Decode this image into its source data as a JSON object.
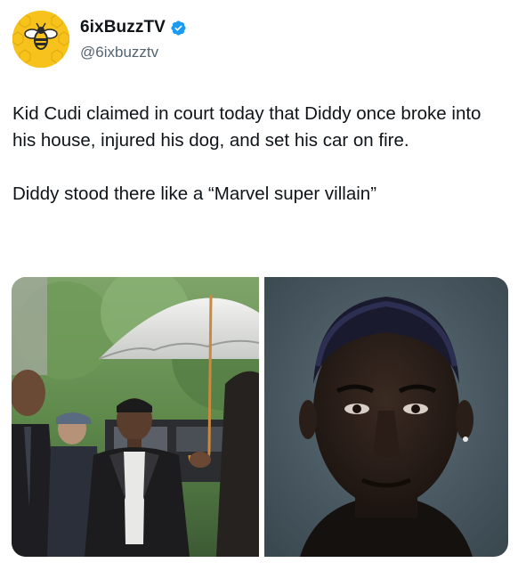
{
  "author": {
    "display_name": "6ixBuzzTV",
    "handle": "@6ixbuzztv",
    "verified": true,
    "avatar_icon": "bee-logo-icon",
    "avatar_color": "#f6c21b"
  },
  "tweet": {
    "paragraphs": [
      "Kid Cudi claimed in court today that Diddy once broke into his house, injured his dog, and set his car on fire.",
      "Diddy stood there like a “Marvel super villain”"
    ]
  },
  "media": {
    "photos": [
      {
        "name": "court-arrival-photo"
      },
      {
        "name": "portrait-photo"
      }
    ]
  },
  "colors": {
    "text": "#0f1419",
    "secondary_text": "#536471",
    "verified_badge": "#1d9bf0"
  }
}
